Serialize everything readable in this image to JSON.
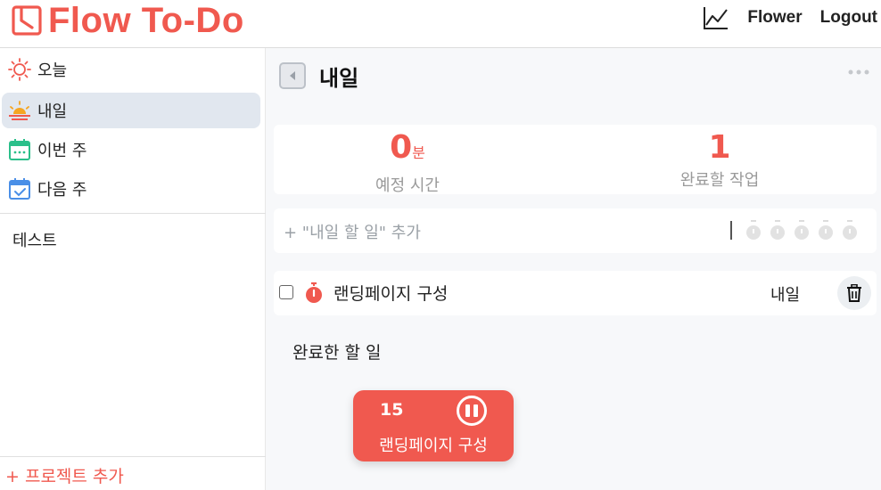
{
  "header": {
    "logo_text": "Flow To-Do",
    "user_label": "Flower",
    "logout_label": "Logout",
    "brand_color": "#f0594f"
  },
  "sidebar": {
    "items": [
      {
        "label": "오늘",
        "icon": "sun-icon",
        "active": false
      },
      {
        "label": "내일",
        "icon": "sunrise-icon",
        "active": true
      },
      {
        "label": "이번 주",
        "icon": "calendar-week-icon",
        "active": false
      },
      {
        "label": "다음 주",
        "icon": "calendar-check-icon",
        "active": false
      }
    ],
    "projects": [
      {
        "label": "테스트"
      }
    ],
    "add_project_label": "+ 프로젝트 추가"
  },
  "main": {
    "title": "내일",
    "stats": {
      "scheduled_time_value": "0",
      "scheduled_time_unit": "분",
      "scheduled_time_label": "예정 시간",
      "remaining_tasks_value": "1",
      "remaining_tasks_label": "완료할 작업"
    },
    "add_task_placeholder": "+ \"내일 할 일\" 추가",
    "tasks": [
      {
        "name": "랜딩페이지 구성",
        "due": "내일",
        "checked": false
      }
    ],
    "completed_title": "완료한 할 일"
  },
  "timer": {
    "count": "15",
    "task": "랜딩페이지 구성"
  }
}
